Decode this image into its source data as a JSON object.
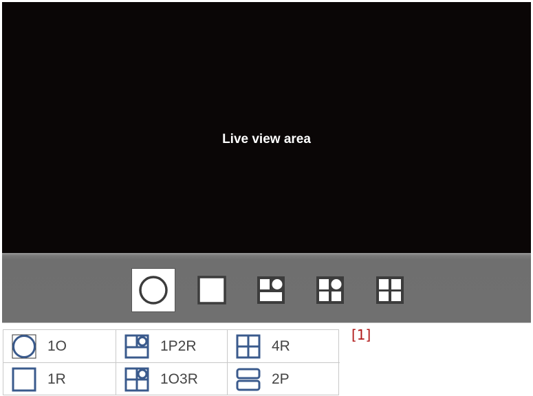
{
  "live_view": {
    "label": "Live view area"
  },
  "toolbar": {
    "buttons": [
      {
        "icon": "circle-1o-icon",
        "active": true
      },
      {
        "icon": "square-1r-icon",
        "active": false
      },
      {
        "icon": "layout-1p2r-icon",
        "active": false
      },
      {
        "icon": "layout-1o3r-icon",
        "active": false
      },
      {
        "icon": "layout-4r-icon",
        "active": false
      }
    ]
  },
  "footnote": "[1]",
  "legend": {
    "items": [
      {
        "icon": "circle-1o-icon",
        "label": "1O"
      },
      {
        "icon": "layout-1p2r-icon",
        "label": "1P2R"
      },
      {
        "icon": "layout-4r-icon",
        "label": "4R"
      },
      {
        "icon": "square-1r-icon",
        "label": "1R"
      },
      {
        "icon": "layout-1o3r-icon",
        "label": "1O3R"
      },
      {
        "icon": "layout-2p-icon",
        "label": "2P"
      }
    ]
  },
  "colors": {
    "live_view_bg": "#0a0606",
    "toolbar_bg": "#707070",
    "toolbar_icon": "#3c3c3c",
    "legend_icon": "#3a5a8c",
    "footnote": "#b01818"
  }
}
